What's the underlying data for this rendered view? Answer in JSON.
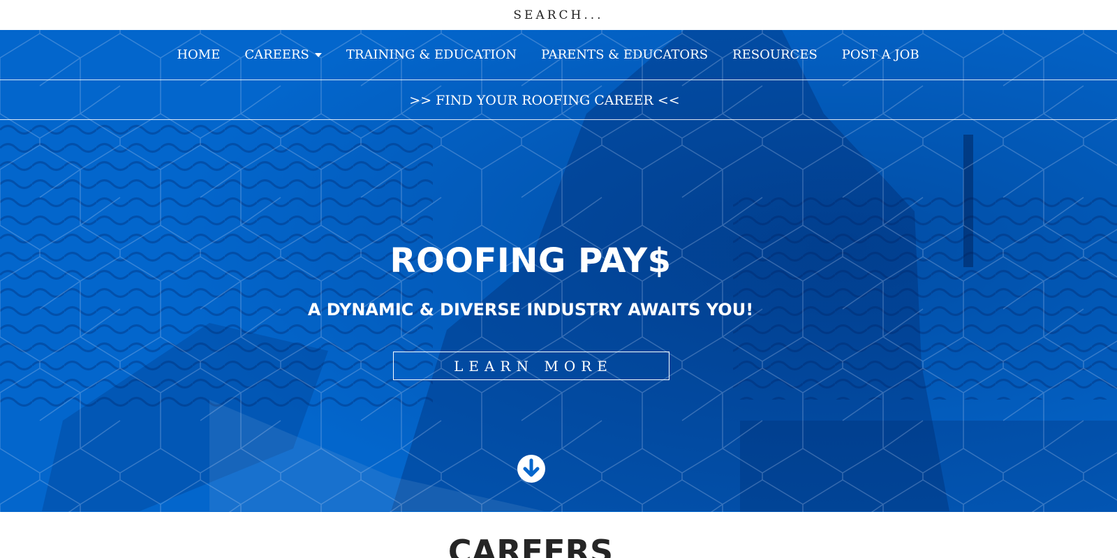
{
  "search": {
    "placeholder": "SEARCH..."
  },
  "nav": {
    "items": [
      {
        "label": "HOME"
      },
      {
        "label": "CAREERS",
        "has_dropdown": true
      },
      {
        "label": "TRAINING & EDUCATION"
      },
      {
        "label": "PARENTS & EDUCATORS"
      },
      {
        "label": "RESOURCES"
      },
      {
        "label": "POST A JOB"
      }
    ]
  },
  "banner": {
    "link_text": ">> FIND YOUR ROOFING CAREER <<"
  },
  "hero": {
    "title": "ROOFING PAY$",
    "subtitle": "A DYNAMIC & DIVERSE INDUSTRY AWAITS YOU!",
    "cta_label": "LEARN MORE",
    "scroll_icon": "arrow-circle-down-icon"
  },
  "section": {
    "title": "CAREERS"
  },
  "colors": {
    "hero_blue": "#0366cc",
    "text_white": "#ffffff",
    "heading_dark": "#252525"
  }
}
